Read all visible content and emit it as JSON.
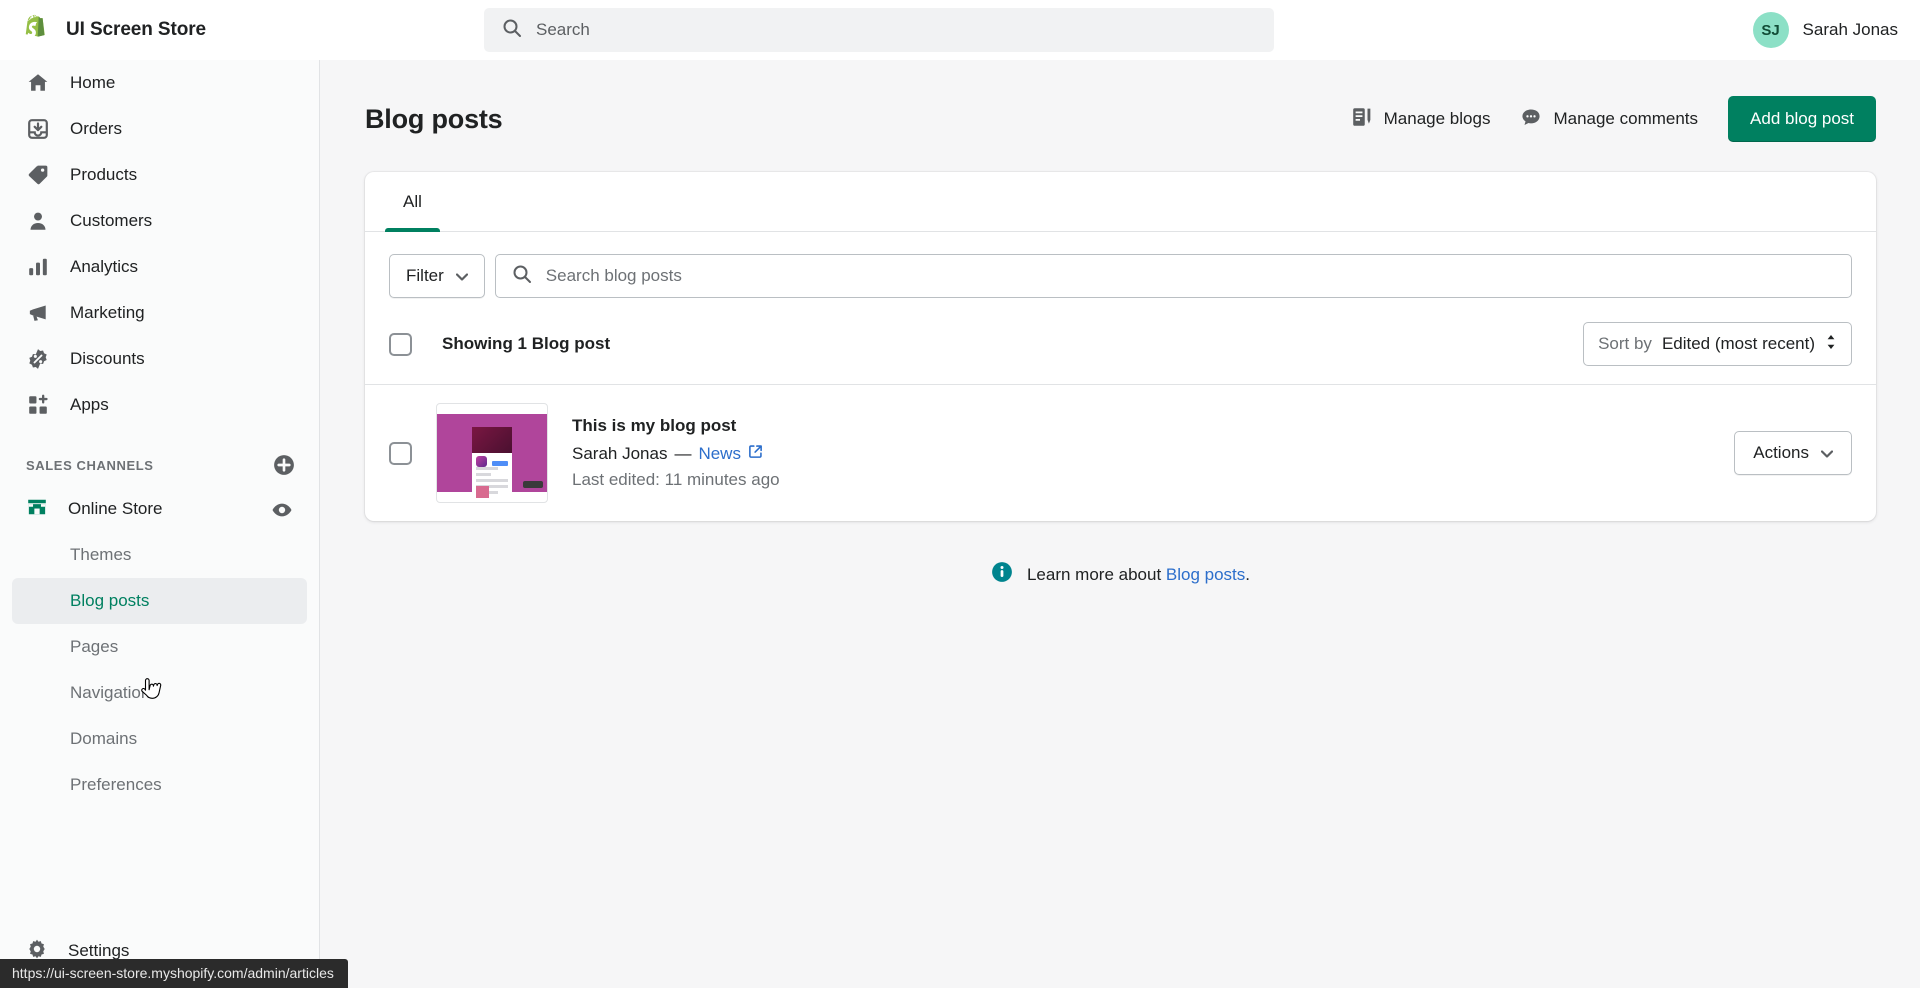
{
  "topbar": {
    "brand_name": "UI Screen Store",
    "logo_icon": "shopify-bag-icon",
    "search": {
      "icon": "search-icon",
      "placeholder": "Search",
      "value": ""
    },
    "user": {
      "initials": "SJ",
      "name": "Sarah Jonas",
      "avatar_color": "#8ce0c6"
    }
  },
  "sidebar": {
    "items": [
      {
        "label": "Home",
        "icon": "home-icon"
      },
      {
        "label": "Orders",
        "icon": "orders-inbox-icon"
      },
      {
        "label": "Products",
        "icon": "product-tag-icon"
      },
      {
        "label": "Customers",
        "icon": "person-icon"
      },
      {
        "label": "Analytics",
        "icon": "bar-chart-icon"
      },
      {
        "label": "Marketing",
        "icon": "megaphone-icon"
      },
      {
        "label": "Discounts",
        "icon": "discount-percent-icon"
      },
      {
        "label": "Apps",
        "icon": "apps-grid-plus-icon"
      }
    ],
    "sales_channels": {
      "title": "SALES CHANNELS",
      "add_icon": "plus-circle-icon",
      "channel": {
        "label": "Online Store",
        "icon": "storefront-icon",
        "view_icon": "eye-icon"
      },
      "sub_items": [
        {
          "label": "Themes",
          "active": false
        },
        {
          "label": "Blog posts",
          "active": true
        },
        {
          "label": "Pages",
          "active": false
        },
        {
          "label": "Navigation",
          "active": false
        },
        {
          "label": "Domains",
          "active": false
        },
        {
          "label": "Preferences",
          "active": false
        }
      ]
    },
    "settings": {
      "label": "Settings",
      "icon": "gear-icon"
    }
  },
  "page": {
    "title": "Blog posts",
    "actions": {
      "manage_blogs": {
        "label": "Manage blogs",
        "icon": "blog-document-icon"
      },
      "manage_comments": {
        "label": "Manage comments",
        "icon": "comment-bubble-icon"
      },
      "add_blog_post": {
        "label": "Add blog post",
        "color": "#008060"
      }
    }
  },
  "card": {
    "tabs": [
      {
        "label": "All",
        "active": true
      }
    ],
    "filter": {
      "label": "Filter",
      "icon": "chevron-down-icon"
    },
    "search": {
      "icon": "search-icon",
      "placeholder": "Search blog posts",
      "value": ""
    },
    "list_head": {
      "select_all_checkbox": false,
      "showing_text": "Showing 1 Blog post",
      "sort": {
        "prefix": "Sort by",
        "value": "Edited (most recent)",
        "icon": "sort-updown-icon"
      }
    },
    "rows": [
      {
        "selected": false,
        "thumbnail_alt": "blog-post-thumbnail",
        "title": "This is my blog post",
        "author": "Sarah Jonas",
        "separator": "—",
        "blog": "News",
        "external_icon": "external-link-icon",
        "last_edited": "Last edited: 11 minutes ago",
        "actions": {
          "label": "Actions",
          "icon": "chevron-down-icon"
        }
      }
    ]
  },
  "footer": {
    "icon": "info-circle-icon",
    "text_prefix": "Learn more about ",
    "link": "Blog posts",
    "text_suffix": "."
  },
  "status_bar": {
    "url": "https://ui-screen-store.myshopify.com/admin/articles"
  }
}
